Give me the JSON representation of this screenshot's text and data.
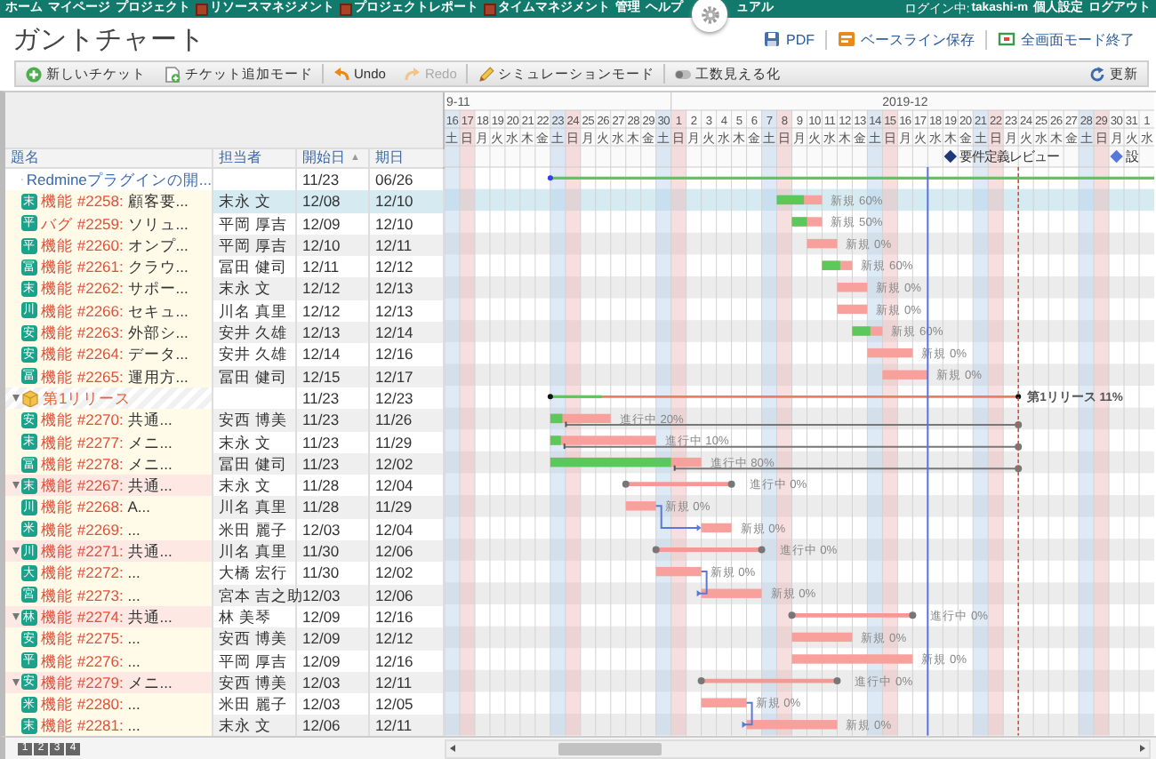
{
  "nav": {
    "items": [
      {
        "kind": "link",
        "label": "ホーム"
      },
      {
        "kind": "link",
        "label": "マイページ"
      },
      {
        "kind": "link",
        "label": "プロジェクト"
      },
      {
        "kind": "module",
        "label": "リソースマネジメント"
      },
      {
        "kind": "module",
        "label": "プロジェクトレポート"
      },
      {
        "kind": "module",
        "label": "タイムマネジメント"
      },
      {
        "kind": "link",
        "label": "管理"
      },
      {
        "kind": "link",
        "label": "ヘルプ"
      },
      {
        "kind": "gear"
      },
      {
        "kind": "link",
        "label": "ュアル"
      }
    ],
    "login_label": "ログイン中:",
    "user": "takashi-m",
    "links": [
      "個人設定",
      "ログアウト"
    ]
  },
  "page_title": "ガントチャート",
  "header_actions": [
    {
      "label": "PDF",
      "kind": "pdf"
    },
    {
      "label": "ベースライン保存",
      "kind": "baseline"
    },
    {
      "label": "全画面モード終了",
      "kind": "fullscreen"
    }
  ],
  "toolbar": {
    "items": [
      {
        "label": "新しいチケット",
        "kind": "add",
        "disabled": false
      },
      {
        "label": "チケット追加モード",
        "kind": "add-doc",
        "disabled": false
      },
      {
        "label": "Undo",
        "kind": "undo",
        "disabled": false
      },
      {
        "label": "Redo",
        "kind": "redo",
        "disabled": true
      },
      {
        "label": "シミュレーションモード",
        "kind": "pencil",
        "disabled": false
      },
      {
        "label": "工数見える化",
        "kind": "toggle",
        "disabled": false
      }
    ],
    "refresh": "更新"
  },
  "table": {
    "columns": [
      {
        "label": "題名"
      },
      {
        "label": "担当者"
      },
      {
        "label": "開始日",
        "sort": "▲"
      },
      {
        "label": "期日"
      }
    ]
  },
  "rows": [
    {
      "kind": "project",
      "subject": "Redmineプラグインの開...",
      "start": "11/23",
      "due": "06/26",
      "selected": false,
      "children": [
        {
          "kind": "issue",
          "tracker": "機能",
          "number": "#2258:",
          "subject": "顧客要...",
          "avatar": "末",
          "assignee": "末永 文",
          "start": "12/08",
          "due": "12/10",
          "status_label": "新規 60%",
          "level": 0.6,
          "selected": true
        },
        {
          "kind": "issue",
          "tracker": "バグ",
          "number": "#2259:",
          "subject": "ソリュ...",
          "avatar": "平",
          "assignee": "平岡 厚吉",
          "start": "12/09",
          "due": "12/10",
          "status_label": "新規 50%",
          "level": 0.5,
          "selected": false
        },
        {
          "kind": "issue",
          "tracker": "機能",
          "number": "#2260:",
          "subject": "オンプ...",
          "avatar": "平",
          "assignee": "平岡 厚吉",
          "start": "12/10",
          "due": "12/11",
          "status_label": "新規 0%",
          "selected": false
        },
        {
          "kind": "issue",
          "tracker": "機能",
          "number": "#2261:",
          "subject": "クラウ...",
          "avatar": "冨",
          "assignee": "冨田 健司",
          "start": "12/11",
          "due": "12/12",
          "status_label": "新規 60%",
          "level": 0.6,
          "selected": false
        },
        {
          "kind": "issue",
          "tracker": "機能",
          "number": "#2262:",
          "subject": "サポー...",
          "avatar": "末",
          "assignee": "末永 文",
          "start": "12/12",
          "due": "12/13",
          "status_label": "新規 0%",
          "selected": false
        },
        {
          "kind": "issue",
          "tracker": "機能",
          "number": "#2266:",
          "subject": "セキュ...",
          "avatar": "川",
          "assignee": "川名 真里",
          "start": "12/12",
          "due": "12/13",
          "status_label": "新規 0%",
          "selected": false
        },
        {
          "kind": "issue",
          "tracker": "機能",
          "number": "#2263:",
          "subject": "外部シ...",
          "avatar": "安",
          "assignee": "安井 久雄",
          "start": "12/13",
          "due": "12/14",
          "status_label": "新規 60%",
          "level": 0.6,
          "selected": false
        },
        {
          "kind": "issue",
          "tracker": "機能",
          "number": "#2264:",
          "subject": "データ...",
          "avatar": "安",
          "assignee": "安井 久雄",
          "start": "12/14",
          "due": "12/16",
          "status_label": "新規 0%",
          "selected": false
        },
        {
          "kind": "issue",
          "tracker": "機能",
          "number": "#2265:",
          "subject": "運用方...",
          "avatar": "冨",
          "assignee": "冨田 健司",
          "start": "12/15",
          "due": "12/17",
          "status_label": "新規 0%",
          "selected": false
        },
        {
          "kind": "version",
          "subject": "第1リリース",
          "start": "11/23",
          "due": "12/23",
          "status_label": "第1リリース 11%",
          "level": 0.11,
          "expanded": true,
          "selected": false,
          "children": [
            {
              "kind": "issue",
              "tracker": "機能",
              "number": "#2270:",
              "subject": "共通...",
              "avatar": "安",
              "assignee": "安西 博美",
              "start": "11/23",
              "due": "11/26",
              "status_label": "進行中 20%",
              "level": 0.2,
              "link": true,
              "selected": false
            },
            {
              "kind": "issue",
              "tracker": "機能",
              "number": "#2277:",
              "subject": "メニ...",
              "avatar": "末",
              "assignee": "末永 文",
              "start": "11/23",
              "due": "11/29",
              "status_label": "進行中 10%",
              "level": 0.1,
              "link": true,
              "selected": false
            },
            {
              "kind": "issue",
              "tracker": "機能",
              "number": "#2278:",
              "subject": "メニ...",
              "avatar": "冨",
              "assignee": "冨田 健司",
              "start": "11/23",
              "due": "12/02",
              "status_label": "進行中 80%",
              "level": 0.8,
              "link": true,
              "selected": false
            },
            {
              "kind": "issue",
              "tracker": "機能",
              "number": "#2267:",
              "subject": "共通...",
              "avatar": "末",
              "assignee": "末永 文",
              "start": "11/28",
              "due": "12/04",
              "status_label": "進行中 0%",
              "expanded": true,
              "selected": false,
              "children": [
                {
                  "kind": "issue",
                  "tracker": "機能",
                  "number": "#2268:",
                  "subject": "A...",
                  "avatar": "川",
                  "assignee": "川名 真里",
                  "start": "11/28",
                  "due": "11/29",
                  "status_label": "新規 0%",
                  "selected": false
                },
                {
                  "kind": "issue",
                  "tracker": "機能",
                  "number": "#2269:",
                  "subject": "...",
                  "avatar": "米",
                  "assignee": "米田 麗子",
                  "start": "12/03",
                  "due": "12/04",
                  "status_label": "新規 0%",
                  "follows": true,
                  "selected": false
                }
              ]
            },
            {
              "kind": "issue",
              "tracker": "機能",
              "number": "#2271:",
              "subject": "共通...",
              "avatar": "川",
              "assignee": "川名 真里",
              "start": "11/30",
              "due": "12/06",
              "status_label": "進行中 0%",
              "expanded": true,
              "selected": false,
              "children": [
                {
                  "kind": "issue",
                  "tracker": "機能",
                  "number": "#2272:",
                  "subject": "...",
                  "avatar": "大",
                  "assignee": "大橋 宏行",
                  "start": "11/30",
                  "due": "12/02",
                  "status_label": "新規 0%",
                  "selected": false
                },
                {
                  "kind": "issue",
                  "tracker": "機能",
                  "number": "#2273:",
                  "subject": "...",
                  "avatar": "宮",
                  "assignee": "宮本 吉之助",
                  "start": "12/03",
                  "due": "12/06",
                  "status_label": "新規 0%",
                  "follows": true,
                  "selected": false
                }
              ]
            },
            {
              "kind": "issue",
              "tracker": "機能",
              "number": "#2274:",
              "subject": "共通...",
              "avatar": "林",
              "assignee": "林 美琴",
              "start": "12/09",
              "due": "12/16",
              "status_label": "進行中 0%",
              "expanded": true,
              "selected": false,
              "children": [
                {
                  "kind": "issue",
                  "tracker": "機能",
                  "number": "#2275:",
                  "subject": "...",
                  "avatar": "安",
                  "assignee": "安西 博美",
                  "start": "12/09",
                  "due": "12/12",
                  "status_label": "新規 0%",
                  "selected": false
                },
                {
                  "kind": "issue",
                  "tracker": "機能",
                  "number": "#2276:",
                  "subject": "...",
                  "avatar": "平",
                  "assignee": "平岡 厚吉",
                  "start": "12/09",
                  "due": "12/16",
                  "status_label": "新規 0%",
                  "selected": false
                }
              ]
            },
            {
              "kind": "issue",
              "tracker": "機能",
              "number": "#2279:",
              "subject": "メニ...",
              "avatar": "安",
              "assignee": "安西 博美",
              "start": "12/03",
              "due": "12/11",
              "status_label": "進行中 0%",
              "expanded": true,
              "selected": false,
              "children": [
                {
                  "kind": "issue",
                  "tracker": "機能",
                  "number": "#2280:",
                  "subject": "...",
                  "avatar": "米",
                  "assignee": "米田 麗子",
                  "start": "12/03",
                  "due": "12/05",
                  "status_label": "新規 0%",
                  "selected": false
                },
                {
                  "kind": "issue",
                  "tracker": "機能",
                  "number": "#2281:",
                  "subject": "...",
                  "avatar": "末",
                  "assignee": "末永 文",
                  "start": "12/06",
                  "due": "12/11",
                  "status_label": "新規 0%",
                  "follows": true,
                  "selected": false
                }
              ]
            }
          ]
        }
      ]
    }
  ],
  "timeline": {
    "months": [
      "9-11",
      "2019-12"
    ],
    "days": [
      {
        "day": "16",
        "weekday": "土",
        "kind": "saturday",
        "today": false
      },
      {
        "day": "17",
        "weekday": "日",
        "kind": "holiday",
        "today": false
      },
      {
        "day": "18",
        "weekday": "月",
        "kind": "weekday",
        "today": false
      },
      {
        "day": "19",
        "weekday": "火",
        "kind": "weekday",
        "today": false
      },
      {
        "day": "20",
        "weekday": "水",
        "kind": "weekday",
        "today": false
      },
      {
        "day": "21",
        "weekday": "木",
        "kind": "weekday",
        "today": false
      },
      {
        "day": "22",
        "weekday": "金",
        "kind": "weekday",
        "today": false
      },
      {
        "day": "23",
        "weekday": "土",
        "kind": "saturday",
        "today": false
      },
      {
        "day": "24",
        "weekday": "日",
        "kind": "holiday",
        "today": false
      },
      {
        "day": "25",
        "weekday": "月",
        "kind": "weekday",
        "today": false
      },
      {
        "day": "26",
        "weekday": "火",
        "kind": "weekday",
        "today": false
      },
      {
        "day": "27",
        "weekday": "水",
        "kind": "weekday",
        "today": false
      },
      {
        "day": "28",
        "weekday": "木",
        "kind": "weekday",
        "today": false
      },
      {
        "day": "29",
        "weekday": "金",
        "kind": "weekday",
        "today": false
      },
      {
        "day": "30",
        "weekday": "土",
        "kind": "saturday",
        "today": false
      },
      {
        "day": "1",
        "weekday": "日",
        "kind": "holiday",
        "today": false
      },
      {
        "day": "2",
        "weekday": "月",
        "kind": "weekday",
        "today": false
      },
      {
        "day": "3",
        "weekday": "火",
        "kind": "weekday",
        "today": false
      },
      {
        "day": "4",
        "weekday": "水",
        "kind": "weekday",
        "today": false
      },
      {
        "day": "5",
        "weekday": "木",
        "kind": "weekday",
        "today": false
      },
      {
        "day": "6",
        "weekday": "金",
        "kind": "weekday",
        "today": false
      },
      {
        "day": "7",
        "weekday": "土",
        "kind": "saturday",
        "today": false
      },
      {
        "day": "8",
        "weekday": "日",
        "kind": "holiday",
        "today": false
      },
      {
        "day": "9",
        "weekday": "月",
        "kind": "weekday",
        "today": false
      },
      {
        "day": "10",
        "weekday": "火",
        "kind": "weekday",
        "today": false
      },
      {
        "day": "11",
        "weekday": "水",
        "kind": "weekday",
        "today": false
      },
      {
        "day": "12",
        "weekday": "木",
        "kind": "weekday",
        "today": false
      },
      {
        "day": "13",
        "weekday": "金",
        "kind": "weekday",
        "today": false
      },
      {
        "day": "14",
        "weekday": "土",
        "kind": "saturday",
        "today": false
      },
      {
        "day": "15",
        "weekday": "日",
        "kind": "holiday",
        "today": false
      },
      {
        "day": "16",
        "weekday": "月",
        "kind": "weekday",
        "today": false
      },
      {
        "day": "17",
        "weekday": "火",
        "kind": "weekday",
        "today": false
      },
      {
        "day": "18",
        "weekday": "水",
        "kind": "weekday",
        "today": true
      },
      {
        "day": "19",
        "weekday": "木",
        "kind": "weekday",
        "today": false,
        "milestone": {
          "label": "要件定義レビュー",
          "color": "#1f3878"
        }
      },
      {
        "day": "20",
        "weekday": "金",
        "kind": "weekday",
        "today": false
      },
      {
        "day": "21",
        "weekday": "土",
        "kind": "saturday",
        "today": false
      },
      {
        "day": "22",
        "weekday": "日",
        "kind": "holiday",
        "today": false
      },
      {
        "day": "23",
        "weekday": "月",
        "kind": "weekday",
        "today": false
      },
      {
        "day": "24",
        "weekday": "火",
        "kind": "weekday",
        "today": false
      },
      {
        "day": "25",
        "weekday": "水",
        "kind": "weekday",
        "today": false
      },
      {
        "day": "26",
        "weekday": "木",
        "kind": "weekday",
        "today": false
      },
      {
        "day": "27",
        "weekday": "金",
        "kind": "weekday",
        "today": false
      },
      {
        "day": "28",
        "weekday": "土",
        "kind": "saturday",
        "today": false
      },
      {
        "day": "29",
        "weekday": "日",
        "kind": "holiday",
        "today": false
      },
      {
        "day": "30",
        "weekday": "月",
        "kind": "weekday",
        "today": false,
        "milestone": {
          "label": "設",
          "color": "#5a78d8"
        }
      },
      {
        "day": "31",
        "weekday": "火",
        "kind": "weekday",
        "today": false
      },
      {
        "day": "1",
        "weekday": "水",
        "kind": "weekday",
        "today": false
      }
    ]
  },
  "pager": [
    "1",
    "2",
    "3",
    "4"
  ]
}
